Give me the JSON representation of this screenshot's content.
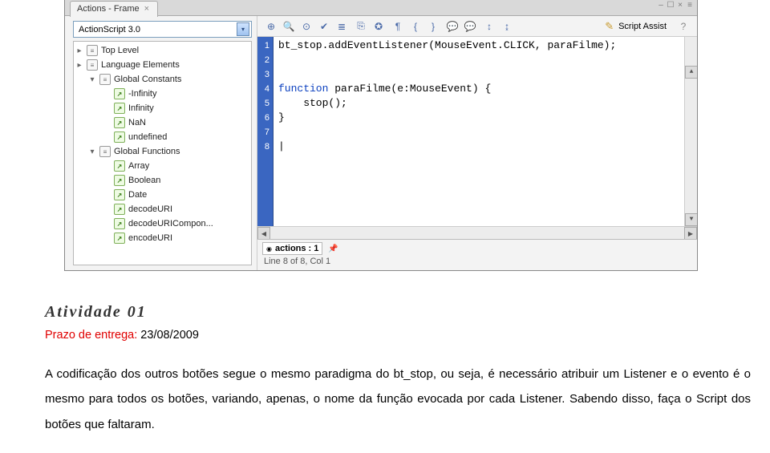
{
  "window": {
    "tab_title": "Actions - Frame",
    "close_glyph": "×"
  },
  "wincontrols": {
    "min": "–",
    "max": "☐",
    "close": "×",
    "menu": "≡"
  },
  "combo": {
    "value": "ActionScript 3.0"
  },
  "tree": [
    {
      "level": 0,
      "icon": "pkg",
      "label": "Top Level",
      "expand": "▸"
    },
    {
      "level": 0,
      "icon": "pkg",
      "label": "Language Elements",
      "expand": "▸"
    },
    {
      "level": 1,
      "icon": "pkg",
      "label": "Global Constants",
      "expand": "▾"
    },
    {
      "level": 2,
      "icon": "leaf",
      "label": "-Infinity"
    },
    {
      "level": 2,
      "icon": "leaf",
      "label": "Infinity"
    },
    {
      "level": 2,
      "icon": "leaf",
      "label": "NaN"
    },
    {
      "level": 2,
      "icon": "leaf",
      "label": "undefined"
    },
    {
      "level": 1,
      "icon": "pkg",
      "label": "Global Functions",
      "expand": "▾"
    },
    {
      "level": 2,
      "icon": "leaf",
      "label": "Array"
    },
    {
      "level": 2,
      "icon": "leaf",
      "label": "Boolean"
    },
    {
      "level": 2,
      "icon": "leaf",
      "label": "Date"
    },
    {
      "level": 2,
      "icon": "leaf",
      "label": "decodeURI"
    },
    {
      "level": 2,
      "icon": "leaf",
      "label": "decodeURICompon..."
    },
    {
      "level": 2,
      "icon": "leaf",
      "label": "encodeURI"
    }
  ],
  "toolbar": {
    "icons": [
      "add",
      "find",
      "target",
      "check",
      "format",
      "bookmark",
      "link",
      "para",
      "brace-open",
      "brace-close",
      "comment1",
      "comment2",
      "expand",
      "collapse"
    ],
    "script_assist": "Script Assist",
    "help": "?"
  },
  "code": {
    "lines": [
      "1",
      "2",
      "3",
      "4",
      "5",
      "6",
      "7",
      "8"
    ],
    "l1_a": "bt_stop.addEventListener(MouseEvent.CLICK, paraFilme);",
    "l4_a": "function",
    "l4_b": " paraFilme(e:MouseEvent) {",
    "l5": "    stop();",
    "l6": "}"
  },
  "status": {
    "nav_label": "actions : 1",
    "pos": "Line 8 of 8, Col 1"
  },
  "activity": {
    "heading": "Atividade 01",
    "prazo_label": "Prazo de entrega:",
    "prazo_value": " 23/08/2009",
    "body": "A codificação dos outros botões segue o mesmo paradigma do bt_stop, ou seja, é necessário atribuir um Listener e o evento é o mesmo para todos os botões, variando, apenas, o nome da função evocada por cada Listener. Sabendo disso, faça o Script dos botões que faltaram."
  }
}
